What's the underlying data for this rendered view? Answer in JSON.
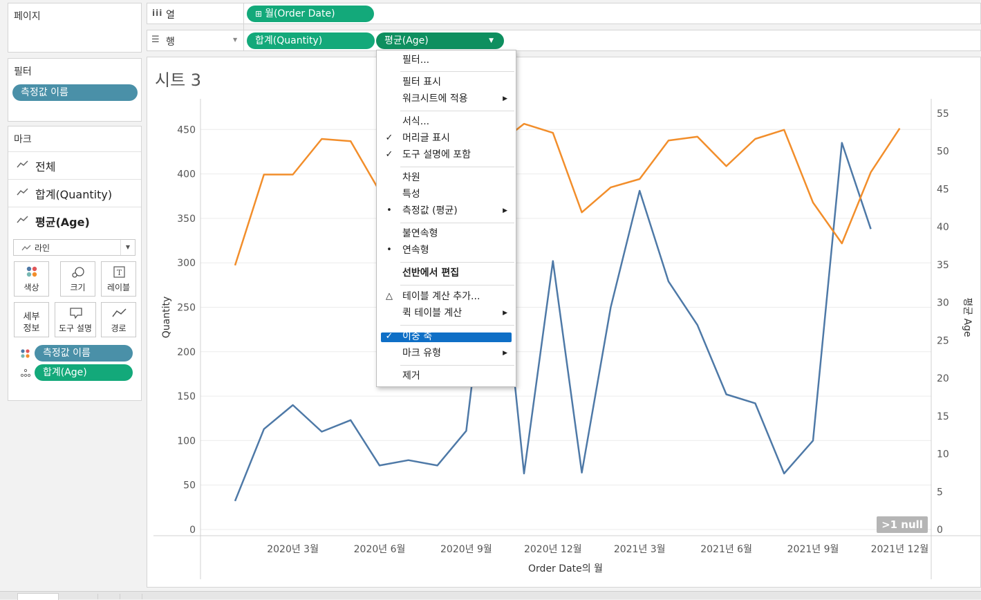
{
  "left_pane": {
    "pages_title": "페이지",
    "filters_title": "필터",
    "filter_pill": "측정값 이름",
    "marks_title": "마크",
    "mark_rows": [
      "전체",
      "합계(Quantity)",
      "평균(Age)"
    ],
    "mark_type": "라인",
    "mark_buttons": {
      "color": "색상",
      "size": "크기",
      "label": "레이블",
      "detail_l1": "세부",
      "detail_l2": "정보",
      "tooltip": "도구 설명",
      "path": "경로"
    },
    "mark_pills": [
      "측정값 이름",
      "합계(Age)"
    ]
  },
  "shelves": {
    "columns_label": "열",
    "rows_label": "행",
    "columns_pill": "월(Order Date)",
    "rows_pills": [
      "합계(Quantity)",
      "평균(Age)"
    ]
  },
  "sheet": {
    "title": "시트 3",
    "null_badge": ">1 null"
  },
  "context_menu": {
    "items": [
      {
        "label": "필터...",
        "mark": "",
        "arrow": false
      },
      {
        "label": "필터 표시",
        "mark": "",
        "arrow": false
      },
      {
        "label": "워크시트에 적용",
        "mark": "",
        "arrow": true
      },
      {
        "label": "서식...",
        "mark": "",
        "arrow": false
      },
      {
        "label": "머리글 표시",
        "mark": "✓",
        "arrow": false
      },
      {
        "label": "도구 설명에 포함",
        "mark": "✓",
        "arrow": false
      },
      {
        "label": "차원",
        "mark": "",
        "arrow": false
      },
      {
        "label": "특성",
        "mark": "",
        "arrow": false
      },
      {
        "label": "측정값 (평균)",
        "mark": "•",
        "arrow": true
      },
      {
        "label": "불연속형",
        "mark": "",
        "arrow": false
      },
      {
        "label": "연속형",
        "mark": "•",
        "arrow": false
      },
      {
        "label": "선반에서 편집",
        "mark": "",
        "arrow": false
      },
      {
        "label": "테이블 계산 추가...",
        "mark": "△",
        "arrow": false
      },
      {
        "label": "퀵 테이블 계산",
        "mark": "",
        "arrow": true
      },
      {
        "label": "이중 축",
        "mark": "✓",
        "arrow": false
      },
      {
        "label": "마크 유형",
        "mark": "",
        "arrow": true
      },
      {
        "label": "제거",
        "mark": "",
        "arrow": false
      }
    ]
  },
  "chart_data": {
    "type": "line",
    "title": "시트 3",
    "xlabel": "Order Date의 월",
    "ylabel_left": "Quantity",
    "ylabel_right": "평균 Age",
    "x": [
      "2020-01",
      "2020-02",
      "2020-03",
      "2020-04",
      "2020-05",
      "2020-06",
      "2020-07",
      "2020-08",
      "2020-09",
      "2020-10",
      "2020-11",
      "2020-12",
      "2021-01",
      "2021-02",
      "2021-03",
      "2021-04",
      "2021-05",
      "2021-06",
      "2021-07",
      "2021-08",
      "2021-09",
      "2021-10",
      "2021-11",
      "2021-12"
    ],
    "x_tick_labels": [
      "2020년 3월",
      "2020년 6월",
      "2020년 9월",
      "2020년 12월",
      "2021년 3월",
      "2021년 6월",
      "2021년 9월",
      "2021년 12월"
    ],
    "y_left_ticks": [
      0,
      50,
      100,
      150,
      200,
      250,
      300,
      350,
      400,
      450
    ],
    "y_right_ticks": [
      0,
      5,
      10,
      15,
      20,
      25,
      30,
      35,
      40,
      45,
      50,
      55
    ],
    "ylim_left": [
      0,
      465
    ],
    "ylim_right": [
      0,
      55.8
    ],
    "series": [
      {
        "name": "합계(Quantity)",
        "axis": "left",
        "color": "#4e79a7",
        "values": [
          32,
          113,
          140,
          110,
          123,
          72,
          78,
          72,
          111,
          380,
          63,
          302,
          64,
          250,
          381,
          279,
          230,
          152,
          142,
          63,
          100,
          435,
          338
        ]
      },
      {
        "name": "평균(Age)",
        "axis": "right",
        "color": "#f28e2b",
        "values": [
          34.9,
          46.9,
          46.9,
          51.6,
          51.3,
          44.7,
          45,
          45.4,
          43,
          50.6,
          53.6,
          52.4,
          41.9,
          45.2,
          46.3,
          51.4,
          51.9,
          48,
          51.6,
          52.8,
          43.2,
          37.8,
          47.2,
          53
        ]
      }
    ],
    "grid": "horizontal"
  }
}
